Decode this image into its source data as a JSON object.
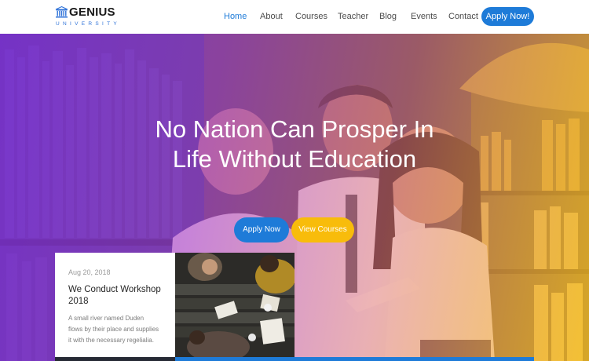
{
  "brand": {
    "name": "GENIUS",
    "subtitle": "UNIVERSITY",
    "icon": "university-building-icon"
  },
  "nav": {
    "items": [
      {
        "label": "Home",
        "active": true
      },
      {
        "label": "About"
      },
      {
        "label": "Courses"
      },
      {
        "label": "Teacher"
      },
      {
        "label": "Blog"
      },
      {
        "label": "Events"
      },
      {
        "label": "Contact"
      }
    ],
    "cta": "Apply Now!"
  },
  "hero": {
    "line1": "No Nation Can Prosper In",
    "line2": "Life Without Education",
    "primary_button": "Apply Now",
    "secondary_button": "View Courses"
  },
  "event": {
    "date": "Aug 20, 2018",
    "title_line1": "We Conduct Workshop",
    "title_line2": "2018",
    "desc_line1": "A small river named Duden",
    "desc_line2": "flows by their place and supplies",
    "desc_line3": "it with the necessary regelialia."
  },
  "colors": {
    "primary": "#1e7bd8",
    "accent": "#f8bc0b",
    "overlay_purple": "#8c2de6",
    "overlay_yellow": "#fabe1e"
  }
}
